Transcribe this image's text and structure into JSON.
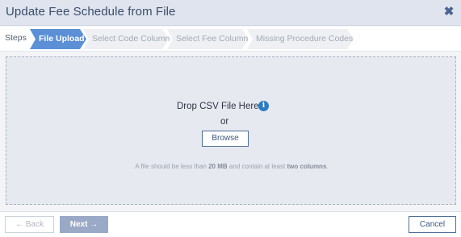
{
  "dialog": {
    "title": "Update Fee Schedule from File",
    "close_glyph": "✖"
  },
  "steps": {
    "label": "Steps",
    "items": [
      {
        "label": "File Upload",
        "active": true
      },
      {
        "label": "Select Code Column",
        "active": false
      },
      {
        "label": "Select Fee Column",
        "active": false
      },
      {
        "label": "Missing Procedure Codes",
        "active": false
      }
    ]
  },
  "dropzone": {
    "prompt": "Drop CSV File Here",
    "info_icon": "info-icon",
    "or": "or",
    "browse_label": "Browse",
    "note_prefix": "A file should be less than ",
    "note_size": "20 MB",
    "note_middle": " and contain at least ",
    "note_columns": "two columns",
    "note_suffix": "."
  },
  "footer": {
    "back_label": "Back",
    "back_arrow": "←",
    "next_label": "Next",
    "next_arrow": "→",
    "cancel_label": "Cancel"
  },
  "colors": {
    "active_step": "#5b8fd6",
    "inactive_step": "#eef0f4",
    "header_bg": "#dfe4ee",
    "accent": "#4f6e96"
  }
}
